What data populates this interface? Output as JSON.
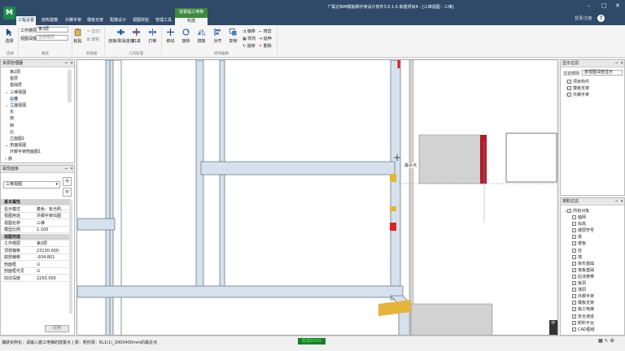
{
  "app": {
    "logo_letter": "M",
    "window_title": "广联达BIM模板脚手架设计软件3.0.1.6 新建项目4 - [三维视图 - 三维]",
    "login_label": "登录/注册",
    "help_glyph": "?",
    "win_controls": [
      "–",
      "□",
      "✕"
    ]
  },
  "menu_tabs": [
    "工程设置",
    "结构建模",
    "外脚手架",
    "模板支架",
    "配模设计",
    "视图校验",
    "管理工具"
  ],
  "context_tab": {
    "group": "放置临工电梯",
    "tab": "构建"
  },
  "ribbon": {
    "select": {
      "label": "选择",
      "group": "选择"
    },
    "floor_label": "工作楼层",
    "floor_value": "第3层",
    "depth_label": "视图深度",
    "depth_placeholder": "全部楼层",
    "floor_group": "楼层",
    "clipboard": {
      "paste": "粘贴",
      "cut": "剪切",
      "copy": "复制",
      "group": "剪贴板"
    },
    "geometry": {
      "cut_join": "连接/取消连接",
      "trim": "扣减",
      "split": "打断",
      "group": "几何处理"
    },
    "modify": {
      "items": [
        "移动",
        "旋转",
        "镜像",
        "对齐",
        "复制"
      ],
      "small_items": [
        "偏移",
        "阵列",
        "旋转",
        "修剪",
        "延伸",
        "删除"
      ],
      "group": "修改编辑"
    }
  },
  "resource_manager": {
    "title": "资源管理器",
    "tree": [
      {
        "label": "第2层",
        "indent": 3
      },
      {
        "label": "首层",
        "indent": 3
      },
      {
        "label": "基础层",
        "indent": 3
      },
      {
        "label": "三维视图",
        "indent": 1,
        "expand": "⌄"
      },
      {
        "label": "三维",
        "indent": 3,
        "selected": true
      },
      {
        "label": "立面视图",
        "indent": 1,
        "expand": "⌄"
      },
      {
        "label": "东",
        "indent": 3
      },
      {
        "label": "南",
        "indent": 3
      },
      {
        "label": "西",
        "indent": 3
      },
      {
        "label": "北",
        "indent": 3
      },
      {
        "label": "立面图1",
        "indent": 3
      },
      {
        "label": "剖面视图",
        "indent": 1,
        "expand": "⌄"
      },
      {
        "label": "外脚手架剖面图1",
        "indent": 3
      },
      {
        "label": "族",
        "indent": 1,
        "expand": "›"
      }
    ]
  },
  "properties": {
    "title": "属性面板",
    "type_value": "三维视图",
    "sections": [
      {
        "title": "基本属性",
        "rows": [
          {
            "k": "显示模式",
            "v": "着色：有光照, ..."
          },
          {
            "k": "视图用途",
            "v": "外脚手架出图"
          },
          {
            "k": "视图名称",
            "v": "三维"
          },
          {
            "k": "模型比例",
            "v": "1:100"
          }
        ]
      },
      {
        "title": "视图范围",
        "rows": [
          {
            "k": "工作楼层",
            "v": "第3层"
          },
          {
            "k": "顶部偏移",
            "v": "23130.000"
          },
          {
            "k": "底部偏移",
            "v": "-934.801"
          },
          {
            "k": "剖面框",
            "v": "☑"
          },
          {
            "k": "剖面框可见",
            "v": "☑"
          },
          {
            "k": "前切深度",
            "v": "2250.000"
          }
        ]
      }
    ],
    "apply_label": "应用"
  },
  "display_filter": {
    "title": "显示过滤",
    "rule_label": "过滤规则",
    "rule_value": "按视图深度显示",
    "items": [
      "项目构件",
      "模板支架",
      "外脚手架"
    ]
  },
  "category_filter": {
    "title": "按职过滤",
    "root": "所有对象",
    "items": [
      "轴网",
      "标高",
      "楼层符号",
      "梁",
      "楼板",
      "柱",
      "墙",
      "条形基础",
      "筏板基础",
      "后浇楼带",
      "板洞",
      "墙洞",
      "外脚手架",
      "模板支架",
      "施工电梯",
      "安全通道",
      "卸料平台",
      "CAD图纸"
    ]
  },
  "canvas": {
    "snap_label": "最近点"
  },
  "statusbar": {
    "text": "捕获实例化：请输入施工电梯的放置点 | 梁：矩形梁：KL1(1)_200X400mm的最近点",
    "badge": "能源810日"
  }
}
